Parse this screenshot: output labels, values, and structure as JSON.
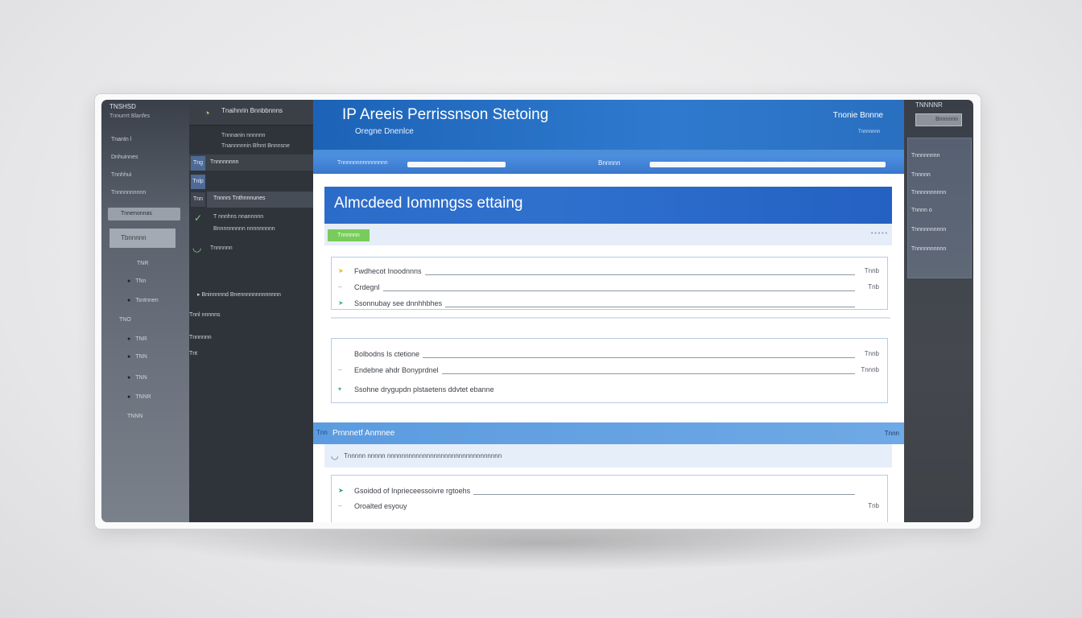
{
  "left_rail": {
    "title": "TNSHSD",
    "subtitle": "Tnnurrrt Blanfes",
    "items": [
      "Tnantn l",
      "Dnhuinnes",
      "Tnnhhui",
      "Tnnnnnnnnnn"
    ],
    "active_item": "Tnnenonnas",
    "button_label": "Tbnnnnn",
    "dots": [
      "TNR",
      "TNn",
      "Tsntnnen",
      "TNO",
      "TNR",
      "TNN",
      "TNN",
      "TNNR",
      "TNNN"
    ]
  },
  "nav": {
    "header_text": "Tnaihnrin Bnnbbnnns",
    "user_lines": [
      "Tnnnanin nnnnnn",
      "Tnannnnnin Bfnnt Bnnnsne"
    ],
    "section_label": "Tnnnnnnnn",
    "icons": [
      "Tng",
      "Tnlp",
      "Tnn"
    ],
    "items": [
      "Tnnnrs Tnthnnnunes",
      "T nnnhns nnannnnn",
      "Bnnnnnnnnn nnnnnnnnn"
    ],
    "circle_label": "Tnnnnnn",
    "footer_item": "Bninnnnnd Bnennnnnnnnnnnnn",
    "footer_labels": [
      "Tnnl nnnnns",
      "Tnnnnnn",
      "Tnt"
    ]
  },
  "header": {
    "title": "IP Areeis Perrissnson Stetoing",
    "subtitle": "Oregne Dnenlce",
    "right_label": "Tnonie Bnnne",
    "right_sub": "Tnnnnnnn"
  },
  "toolbar": {
    "left_text": "Tnnnnnnnnnnnnnnn",
    "search_label": "Bnnnnn"
  },
  "banner": {
    "title": "Almcdeed Iomnngss ettaing",
    "tag": "Tnnnnnn",
    "dots": "• • • • •"
  },
  "card1": {
    "rows": [
      {
        "label": "Fwdhecot Inoodnnns",
        "value": "Tnnb"
      },
      {
        "label": "Crdegnl",
        "value": "Tnb"
      },
      {
        "label": "Ssonnubay see dnnhhbhes",
        "value": ""
      }
    ]
  },
  "card2": {
    "rows": [
      {
        "label": "Bolbodns Is ctetione",
        "value": "Tnnb"
      },
      {
        "label": "Endebne ahdr Bonyprdnel",
        "value": "Tnnnb"
      },
      {
        "label": "Ssohne drygupdn plstaetens ddvtet ebanne",
        "value": ""
      }
    ]
  },
  "section": {
    "icon": "Tnn",
    "title": "Prnnnetf Anmnee",
    "right": "Tnnn"
  },
  "info": {
    "text": "Tnnnnn nnnnn nnnnnnnnnnnnnnnnnnnnnnnnnnnnnnnn"
  },
  "card3": {
    "rows": [
      {
        "label": "Gsoidod of Inprieceessoivre rgtoehs",
        "value": ""
      },
      {
        "label": "Oroalted esyouy",
        "value": "Tnb"
      }
    ]
  },
  "right_panel": {
    "title": "TNNNNR",
    "button_label": "Bnnnnnn",
    "items": [
      "Tnnnnnnnn",
      "Tnnnnn",
      "Tnnnnnnnnnn",
      "Tnnnn  o",
      "Tnnnnnnnnnn",
      "Tnnnnnnnnnn"
    ]
  },
  "colors": {
    "primary_blue": "#1c63b7",
    "banner_blue": "#2c6cc9",
    "section_blue": "#5b9bdf",
    "tag_green": "#79cc5c",
    "dark_sidebar": "#2f343b"
  }
}
